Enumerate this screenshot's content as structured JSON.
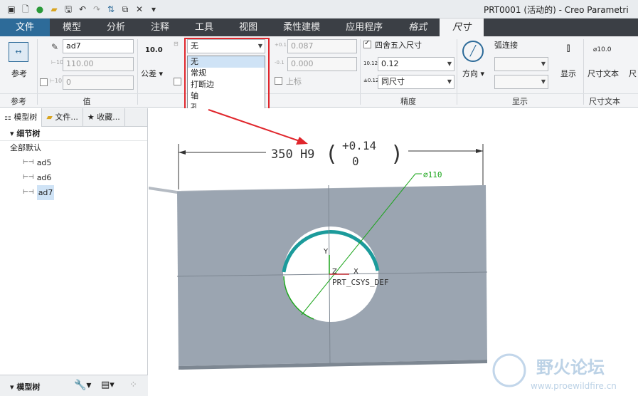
{
  "window": {
    "title": "PRT0001 (活动的) - Creo Parametri"
  },
  "tabs": [
    {
      "label": "文件"
    },
    {
      "label": "模型"
    },
    {
      "label": "分析"
    },
    {
      "label": "注释"
    },
    {
      "label": "工具"
    },
    {
      "label": "视图"
    },
    {
      "label": "柔性建模"
    },
    {
      "label": "应用程序"
    },
    {
      "label": "格式"
    },
    {
      "label": "尺寸"
    }
  ],
  "ribbon": {
    "groups": {
      "reference": "参考",
      "value": "值",
      "precision": "精度",
      "display": "显示",
      "dimtext": "尺寸文本"
    },
    "reference_button": "参考",
    "dim_name": "ad7",
    "value_field": "110.00",
    "override_field": "0",
    "tolerance_preview": "10.0",
    "tolerance_label": "公差",
    "upper_tol": "0.087",
    "lower_tol": "0.000",
    "upper_label": "上标",
    "round_label": "四舍五入尺寸",
    "decimal_value": "0.12",
    "decimal_places_label": "同尺寸",
    "direction_label": "方向",
    "arc_label": "弧连接",
    "display_label": "显示",
    "dimtext_label": "尺寸文本",
    "dimtext_preview": "⌀10.0",
    "fit_dropdown": {
      "selected": "无",
      "options": [
        "无",
        "常规",
        "打断边",
        "轴",
        "孔"
      ]
    }
  },
  "left_panel": {
    "tabs": [
      "模型树",
      "文件...",
      "收藏..."
    ],
    "tree_header": "细节树",
    "tree_default": "全部默认",
    "items": [
      "ad5",
      "ad6",
      "ad7"
    ],
    "bottom_label": "模型树"
  },
  "drawing": {
    "dimension_main": "350 H9",
    "tol_upper": "+0.14",
    "tol_lower": "0",
    "diameter_label": "⌀110",
    "axis_x": "X",
    "axis_y": "Y",
    "axis_z": "Z",
    "csys_label": "PRT_CSYS_DEF"
  },
  "watermark": {
    "title": "野火论坛",
    "url": "www.proewildfire.cn"
  },
  "colors": {
    "accent": "#2d6b99",
    "part": "#9ba5b1",
    "callout": "#e0262c",
    "dim_green": "#1aa51a"
  }
}
